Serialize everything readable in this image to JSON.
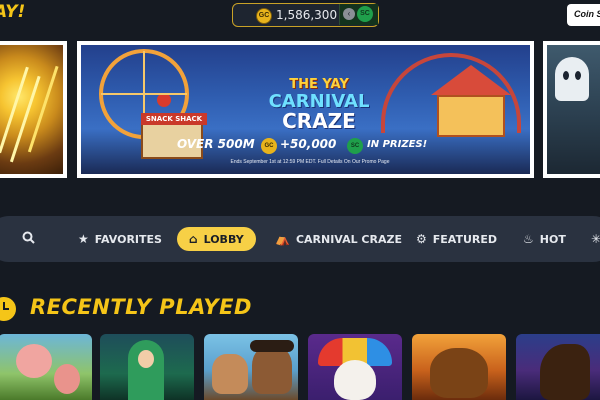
{
  "header": {
    "logo_text": "AY!",
    "balance": {
      "gc_badge": "GC",
      "amount": "1,586,300",
      "toggle_icon": "chevron-left-icon",
      "sc_badge": "SC"
    },
    "coin_store_label": "Coin S"
  },
  "banner": {
    "snack_label": "SNACK SHACK",
    "title_line1": "THE YAY",
    "title_line2": "CARNIVAL",
    "title_line3": "CRAZE",
    "prize_over": "OVER 500M",
    "prize_gc_badge": "GC",
    "prize_plus": "+50,000",
    "prize_sc_badge": "SC",
    "prize_suffix": "IN PRIZES!",
    "fine_print": "Ends September 1st at 12:59 PM EDT. Full Details On Our Promo Page"
  },
  "nav": {
    "items": [
      {
        "label": "",
        "icon": "search-icon"
      },
      {
        "label": "FAVORITES",
        "icon": "star-icon"
      },
      {
        "label": "LOBBY",
        "icon": "home-icon",
        "active": true
      },
      {
        "label": "CARNIVAL CRAZE",
        "icon": "carnival-icon"
      },
      {
        "label": "FEATURED",
        "icon": "medal-icon"
      },
      {
        "label": "HOT",
        "icon": "flame-icon"
      },
      {
        "label": "",
        "icon": "sparkle-icon"
      }
    ]
  },
  "recently_played": {
    "title": "RECENTLY PLAYED",
    "icon": "clock-icon",
    "games": [
      {
        "theme": "pig-farm"
      },
      {
        "theme": "green-sorceress"
      },
      {
        "theme": "pirate-dogs"
      },
      {
        "theme": "jester-joker"
      },
      {
        "theme": "golden-buffalo"
      },
      {
        "theme": "wild-horse"
      }
    ]
  },
  "colors": {
    "background": "#151a22",
    "accent_yellow": "#f5c518",
    "nav_bg": "#2a3240",
    "active_pill": "#f7d046",
    "gc_gold": "#e8b31c",
    "sc_green": "#1f9f4b"
  }
}
